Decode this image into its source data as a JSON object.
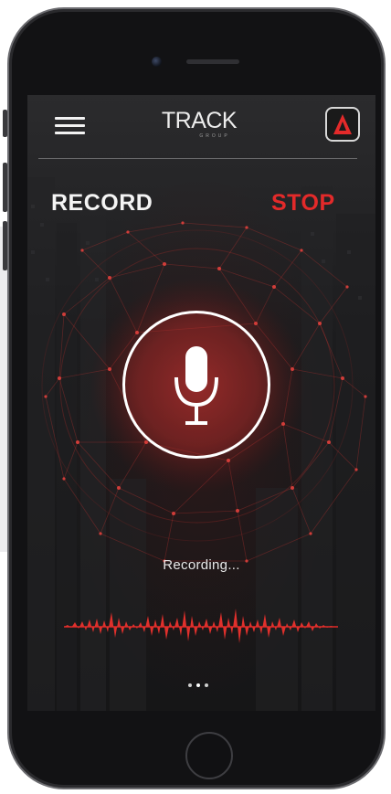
{
  "header": {
    "logo_text": "TRACK",
    "logo_subtext": "GROUP",
    "menu_icon": "hamburger-menu-icon",
    "app_icon": "red-triangle-logo-icon"
  },
  "controls": {
    "record_label": "RECORD",
    "stop_label": "STOP",
    "mic_icon": "microphone-icon"
  },
  "status": {
    "recording_text": "Recording..."
  },
  "pager": {
    "total_pages": 3,
    "active_page": 2
  },
  "colors": {
    "accent": "#e32a2a",
    "text": "#f4f4f4",
    "background": "#1c1c1e"
  }
}
